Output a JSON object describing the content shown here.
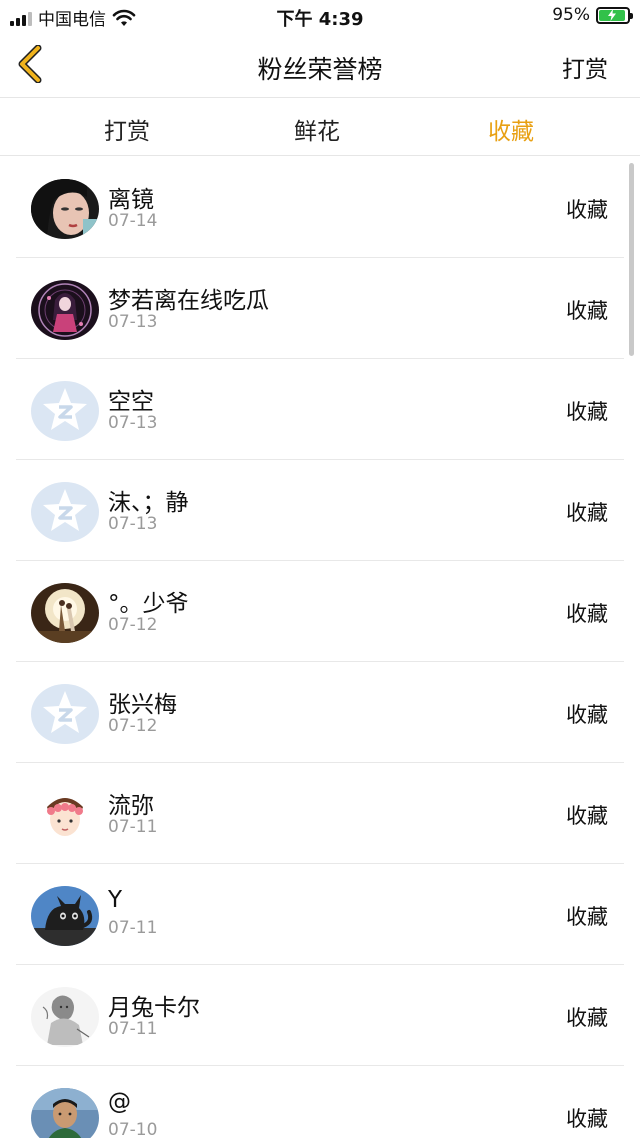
{
  "status_bar": {
    "carrier": "中国电信",
    "time": "下午 4:39",
    "battery": "95%"
  },
  "nav": {
    "title": "粉丝荣誉榜",
    "right_label": "打赏"
  },
  "tabs": [
    {
      "label": "打赏",
      "active": false
    },
    {
      "label": "鲜花",
      "active": false
    },
    {
      "label": "收藏",
      "active": true
    }
  ],
  "colors": {
    "accent": "#e8a013",
    "back_icon": "#f0b31c",
    "default_avatar": "#dbe6f3"
  },
  "fans": [
    {
      "name": "离镜",
      "date": "07-14",
      "action": "收藏",
      "avatar": "photo-avatar-woman"
    },
    {
      "name": "梦若离在线吃瓜",
      "date": "07-13",
      "action": "收藏",
      "avatar": "anime-avatar"
    },
    {
      "name": "空空",
      "date": "07-13",
      "action": "收藏",
      "avatar": "default-star-avatar"
    },
    {
      "name": "沫、；静",
      "date": "07-13",
      "action": "收藏",
      "avatar": "default-star-avatar"
    },
    {
      "name": "°。少爷",
      "date": "07-12",
      "action": "收藏",
      "avatar": "photo-avatar-couple"
    },
    {
      "name": "张兴梅",
      "date": "07-12",
      "action": "收藏",
      "avatar": "default-star-avatar"
    },
    {
      "name": "流弥",
      "date": "07-11",
      "action": "收藏",
      "avatar": "cartoon-avatar"
    },
    {
      "name": "Y",
      "date": "07-11",
      "action": "收藏",
      "avatar": "cat-avatar"
    },
    {
      "name": "月兔卡尔",
      "date": "07-11",
      "action": "收藏",
      "avatar": "sketch-avatar"
    },
    {
      "name": "@",
      "date": "07-10",
      "action": "收藏",
      "avatar": "photo-avatar-man"
    }
  ]
}
